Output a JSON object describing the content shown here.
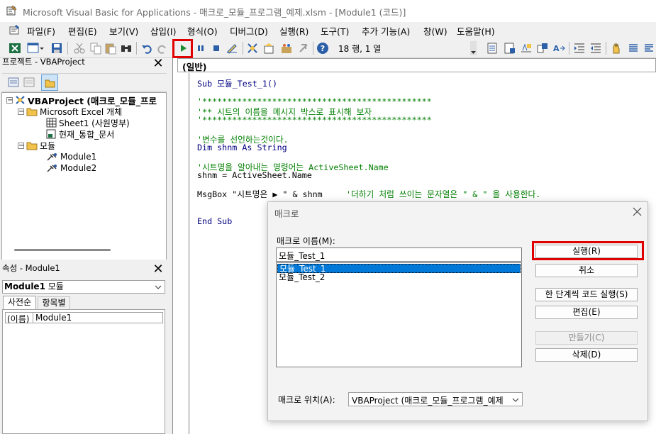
{
  "window": {
    "title": "Microsoft Visual Basic for Applications - 매크로_모듈_프로그램_예제.xlsm - [Module1 (코드)]"
  },
  "menu": [
    "파일(F)",
    "편집(E)",
    "보기(V)",
    "삽입(I)",
    "형식(O)",
    "디버그(D)",
    "실행(R)",
    "도구(T)",
    "추가 기능(A)",
    "창(W)",
    "도움말(H)"
  ],
  "toolbar": {
    "cursor_position": "18 행, 1 열"
  },
  "project_pane": {
    "title": "프로젝트 - VBAProject",
    "tree": {
      "project": "VBAProject (매크로_모듈_프로",
      "excel_objects": "Microsoft Excel 개체",
      "sheet1": "Sheet1 (사원명부)",
      "workbook": "현재_통합_문서",
      "modules": "모듈",
      "module1": "Module1",
      "module2": "Module2"
    }
  },
  "properties_pane": {
    "title": "속성 - Module1",
    "object_name": "Module1",
    "object_type": "모듈",
    "tab_alpha": "사전순",
    "tab_category": "항목별",
    "prop_name": "(이름)",
    "prop_value": "Module1"
  },
  "code_window": {
    "object_combo": "(일반)",
    "lines": [
      "Sub 모듈_Test_1()",
      "'**********************************************",
      "'** 시트의 이름을 메시지 박스로 표시해 보자",
      "'**********************************************",
      "'변수를 선언하는것이다.",
      "Dim shnm As String",
      "'시트명을 알아내는 명령어는 ActiveSheet.Name",
      "shnm = ActiveSheet.Name",
      "MsgBox \"시트명은 ▶ \" & shnm",
      "'더하기 처럼 쓰이는 문자열은 \" & \" 을 사용한다.",
      "End Sub"
    ]
  },
  "macro_dialog": {
    "title": "매크로",
    "name_label": "매크로 이름(M):",
    "name_value": "모듈_Test_1",
    "list_items": [
      "모듈_Test_1",
      "모듈_Test_2"
    ],
    "buttons": {
      "run": "실행(R)",
      "cancel": "취소",
      "step_into": "한 단계씩 코드 실행(S)",
      "edit": "편집(E)",
      "create": "만들기(C)",
      "delete": "삭제(D)"
    },
    "location_label": "매크로 위치(A):",
    "location_value": "VBAProject (매크로_모듈_프로그램_예제"
  },
  "colors": {
    "highlight_red": "#e00000",
    "selection_blue": "#0078d7",
    "comment_green": "#007f00",
    "keyword_navy": "#000080"
  }
}
